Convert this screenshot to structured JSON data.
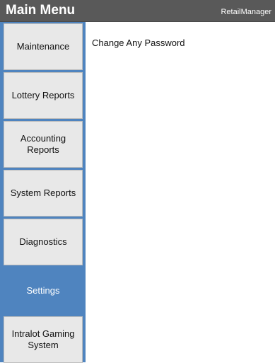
{
  "header": {
    "title": "Main Menu",
    "app_name": "RetailManager"
  },
  "sidebar": {
    "items": [
      {
        "label": "Maintenance",
        "active": false
      },
      {
        "label": "Lottery Reports",
        "active": false
      },
      {
        "label": "Accounting Reports",
        "active": false
      },
      {
        "label": "System Reports",
        "active": false
      },
      {
        "label": "Diagnostics",
        "active": false
      },
      {
        "label": "Settings",
        "active": true
      },
      {
        "label": "Intralot Gaming System",
        "active": false
      }
    ]
  },
  "content": {
    "items": [
      {
        "label": "Change Any Password"
      }
    ]
  },
  "colors": {
    "header_bg": "#595959",
    "accent": "#4f84bf",
    "menu_bg": "#e8e8e8"
  }
}
